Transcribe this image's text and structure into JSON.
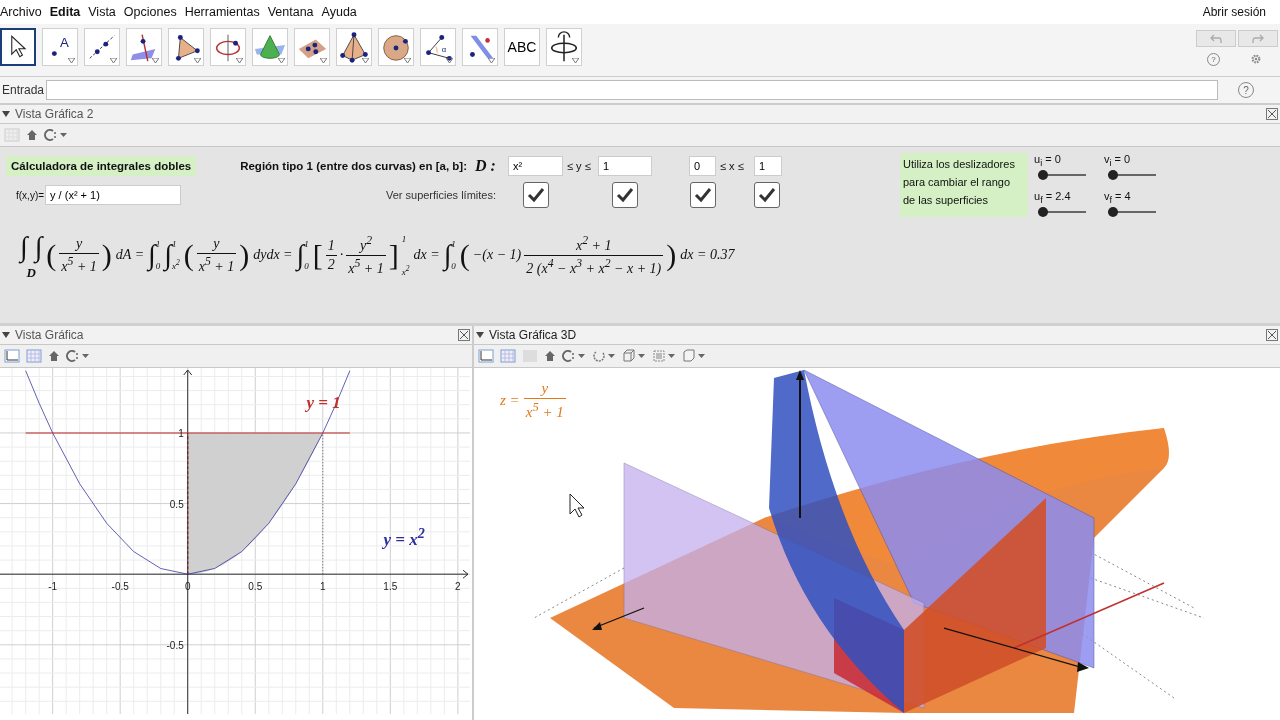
{
  "menu": [
    "Archivo",
    "Edita",
    "Vista",
    "Opciones",
    "Herramientas",
    "Ventana",
    "Ayuda"
  ],
  "signin": "Abrir sesión",
  "top_help": "?",
  "tools": [
    {
      "kind": "pointer",
      "selected": true
    },
    {
      "kind": "point",
      "glyph": "A",
      "selected": false
    },
    {
      "kind": "line",
      "selected": false
    },
    {
      "kind": "perpendicular",
      "selected": false
    },
    {
      "kind": "polygon",
      "selected": false
    },
    {
      "kind": "circle",
      "selected": false
    },
    {
      "kind": "cone",
      "selected": false
    },
    {
      "kind": "plane",
      "selected": false
    },
    {
      "kind": "pyramid",
      "selected": false
    },
    {
      "kind": "sphere",
      "selected": false
    },
    {
      "kind": "angle",
      "glyph": "α",
      "selected": false
    },
    {
      "kind": "reflect",
      "selected": false
    },
    {
      "kind": "text",
      "label": "ABC",
      "selected": false
    },
    {
      "kind": "rotate",
      "selected": false
    }
  ],
  "entrada": {
    "label": "Entrada",
    "help": "?"
  },
  "view2": {
    "title": "Vista Gráfica 2",
    "calc_title": "Cálculadora de integrales dobles",
    "f_label": "f(x,y)=",
    "f_value": "y / (x² + 1)",
    "region_label": "Región tipo 1 (entre dos curvas) en [a, b]:",
    "d_label": "D :",
    "y_lower": "x²",
    "y_rel": "≤ y ≤",
    "y_upper": "1",
    "x_lower": "0",
    "x_rel": "≤ x ≤",
    "x_upper": "1",
    "show_label": "Ver superficies límites:",
    "checkboxes": [
      {
        "checked": true
      },
      {
        "checked": true
      },
      {
        "checked": true
      },
      {
        "checked": true
      }
    ],
    "hint": "Utiliza los deslizadores para cambiar el rango de las superficies",
    "sliders": [
      {
        "label": "u$_{i}$ = 0",
        "level": 0
      },
      {
        "label": "v$_{i}$ = 0",
        "level": 0
      },
      {
        "label": "u$_{f}$ = 2.4",
        "level": 0
      },
      {
        "label": "v$_{f}$ = 4",
        "level": 0
      }
    ],
    "formula": [
      {
        "kind": "int",
        "sym": "∫ ∫",
        "below": "D"
      },
      {
        "kind": "group",
        "open": "(",
        "close": ")",
        "items": [
          {
            "kind": "frac",
            "num": "y",
            "den": "x$^{5}$ + 1"
          }
        ]
      },
      {
        "kind": "text",
        "text": "dA ="
      },
      {
        "kind": "int",
        "sym": "∫",
        "upper": "1",
        "lower": "0"
      },
      {
        "kind": "int",
        "sym": "∫",
        "upper": "1",
        "lower": "x$^{2}$"
      },
      {
        "kind": "group",
        "open": "(",
        "close": ")",
        "items": [
          {
            "kind": "frac",
            "num": "y",
            "den": "x$^{5}$ + 1"
          }
        ]
      },
      {
        "kind": "text",
        "text": "dydx ="
      },
      {
        "kind": "int",
        "sym": "∫",
        "upper": "1",
        "lower": "0"
      },
      {
        "kind": "group",
        "open": "[",
        "close": "]",
        "upper": "1",
        "lower": "x$^{2}$",
        "items": [
          {
            "kind": "frac",
            "num": "1",
            "den": "2"
          },
          {
            "kind": "text",
            "text": "·"
          },
          {
            "kind": "frac",
            "num": "y$^{2}$",
            "den": "x$^{5}$ + 1"
          }
        ]
      },
      {
        "kind": "text",
        "text": "dx ="
      },
      {
        "kind": "int",
        "sym": "∫",
        "upper": "1",
        "lower": "0"
      },
      {
        "kind": "group",
        "open": "(",
        "close": ")",
        "items": [
          {
            "kind": "text",
            "text": "−(x − 1)"
          },
          {
            "kind": "frac",
            "num": "x$^{2}$ + 1",
            "den": "2 (x$^{4}$ − x$^{3}$ + x$^{2}$ − x + 1)"
          }
        ]
      },
      {
        "kind": "text",
        "text": "dx = 0.37"
      }
    ]
  },
  "view1": {
    "title": "Vista Gráfica",
    "chart_data": {
      "type": "line",
      "x": [
        -1.2,
        -1.1,
        -1,
        -0.8,
        -0.6,
        -0.4,
        -0.2,
        0,
        0.2,
        0.4,
        0.6,
        0.8,
        1,
        1.1,
        1.2
      ],
      "series": [
        {
          "name": "y = x$^{2}$",
          "color": "#2e2e9e",
          "values": [
            1.44,
            1.21,
            1,
            0.64,
            0.36,
            0.16,
            0.04,
            0,
            0.04,
            0.16,
            0.36,
            0.64,
            1,
            1.21,
            1.44
          ]
        },
        {
          "name": "y = 1",
          "color": "#c0302e",
          "values": [
            1,
            1,
            1,
            1,
            1,
            1,
            1,
            1,
            1,
            1,
            1,
            1,
            1,
            1,
            1
          ]
        }
      ],
      "grid": true,
      "xlim": [
        -1.39,
        2.09
      ],
      "ylim": [
        -0.99,
        1.46
      ],
      "xticks": [
        -1,
        -0.5,
        0,
        0.5,
        1,
        1.5,
        2
      ],
      "yticks": [
        -0.5,
        0.5,
        1
      ]
    }
  },
  "view3d": {
    "title": "Vista Gráfica 3D",
    "eq_lhs": "z =",
    "eq_num": "y",
    "eq_den": "x$^{5}$ + 1"
  }
}
